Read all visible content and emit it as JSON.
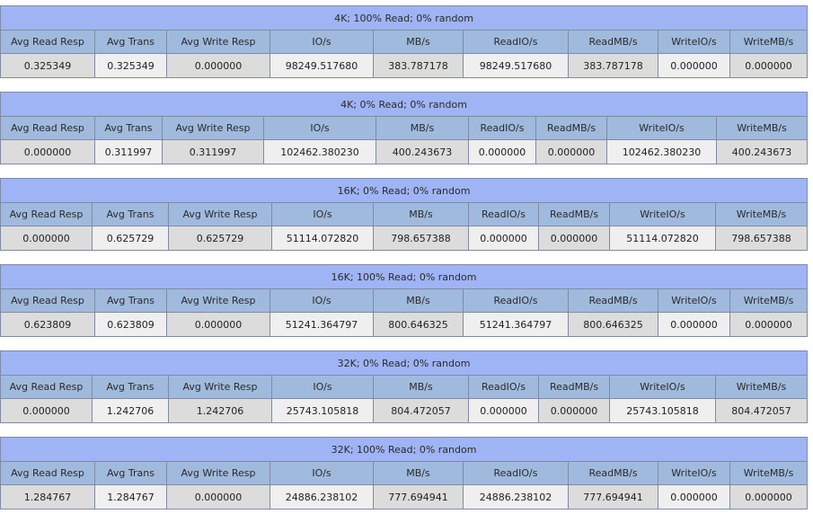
{
  "headers": [
    "Avg Read Resp",
    "Avg Trans",
    "Avg Write Resp",
    "IO/s",
    "MB/s",
    "ReadIO/s",
    "ReadMB/s",
    "WriteIO/s",
    "WriteMB/s"
  ],
  "tables": [
    {
      "title": "4K; 100% Read; 0% random",
      "values": [
        "0.325349",
        "0.325349",
        "0.000000",
        "98249.517680",
        "383.787178",
        "98249.517680",
        "383.787178",
        "0.000000",
        "0.000000"
      ]
    },
    {
      "title": "4K; 0% Read; 0% random",
      "values": [
        "0.000000",
        "0.311997",
        "0.311997",
        "102462.380230",
        "400.243673",
        "0.000000",
        "0.000000",
        "102462.380230",
        "400.243673"
      ]
    },
    {
      "title": "16K; 0% Read; 0% random",
      "values": [
        "0.000000",
        "0.625729",
        "0.625729",
        "51114.072820",
        "798.657388",
        "0.000000",
        "0.000000",
        "51114.072820",
        "798.657388"
      ]
    },
    {
      "title": "16K; 100% Read; 0% random",
      "values": [
        "0.623809",
        "0.623809",
        "0.000000",
        "51241.364797",
        "800.646325",
        "51241.364797",
        "800.646325",
        "0.000000",
        "0.000000"
      ]
    },
    {
      "title": "32K; 0% Read; 0% random",
      "values": [
        "0.000000",
        "1.242706",
        "1.242706",
        "25743.105818",
        "804.472057",
        "0.000000",
        "0.000000",
        "25743.105818",
        "804.472057"
      ]
    },
    {
      "title": "32K; 100% Read; 0% random",
      "values": [
        "1.284767",
        "1.284767",
        "0.000000",
        "24886.238102",
        "777.694941",
        "24886.238102",
        "777.694941",
        "0.000000",
        "0.000000"
      ]
    }
  ]
}
